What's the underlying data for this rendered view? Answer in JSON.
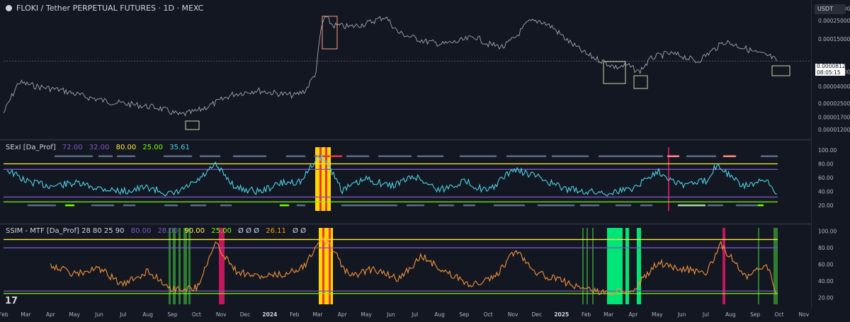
{
  "header": {
    "symbol_title": "FLOKI / Tether PERPETUAL FUTURES · 1D · MEXC",
    "currency_button": "USDT",
    "last_price": "0.00008129",
    "countdown": "08:05:15"
  },
  "indicator1": {
    "name": "SExI [Da_Prof]",
    "values": [
      {
        "text": "72.00",
        "color": "#7e57c2"
      },
      {
        "text": "32.00",
        "color": "#7e57c2"
      },
      {
        "text": "80.00",
        "color": "#ffeb3b"
      },
      {
        "text": "25.00",
        "color": "#76ff03"
      },
      {
        "text": "35.61",
        "color": "#4dd0e1"
      }
    ]
  },
  "indicator2": {
    "name": "SSIM - MTF [Da_Prof] 28 80 25 90",
    "values": [
      {
        "text": "80.00",
        "color": "#7e57c2"
      },
      {
        "text": "28.00",
        "color": "#7e57c2"
      },
      {
        "text": "90.00",
        "color": "#ffeb3b"
      },
      {
        "text": "25.00",
        "color": "#76ff03"
      },
      {
        "text": "Ø Ø Ø",
        "color": "#b2b5be"
      },
      {
        "text": "26.11",
        "color": "#ff9800"
      },
      {
        "text": "Ø Ø",
        "color": "#b2b5be"
      }
    ]
  },
  "colors": {
    "background": "#131722",
    "price_line": "#b2b5be",
    "sexi_line": "#4dd0e1",
    "ssim_line": "#f0913a",
    "upper_band": "#ffeb3b",
    "mid_band": "#7e57c2",
    "lower_band": "#76ff03",
    "dot_row": "#5d6b87",
    "highlight_yellow": "#ffd600",
    "highlight_green": "#00e676",
    "highlight_magenta": "#c2185b",
    "box_color": "#c4d9a8",
    "box_color_top": "#ff9e80"
  },
  "chart_data": [
    {
      "type": "line",
      "name": "FLOKI/USDT price (log scale)",
      "scale": "log",
      "x": [
        "2023-02-01",
        "2023-02-20",
        "2023-03-15",
        "2023-04-15",
        "2023-05-15",
        "2023-06-15",
        "2023-07-15",
        "2023-08-15",
        "2023-09-10",
        "2023-10-01",
        "2023-10-20",
        "2023-11-15",
        "2023-12-15",
        "2024-01-10",
        "2024-02-01",
        "2024-02-15",
        "2024-02-28",
        "2024-03-05",
        "2024-03-10",
        "2024-03-20",
        "2024-04-10",
        "2024-05-01",
        "2024-05-25",
        "2024-06-10",
        "2024-06-25",
        "2024-07-15",
        "2024-08-05",
        "2024-08-25",
        "2024-09-15",
        "2024-10-01",
        "2024-10-20",
        "2024-11-05",
        "2024-11-20",
        "2024-12-05",
        "2024-12-20",
        "2025-01-10",
        "2025-02-01",
        "2025-02-20",
        "2025-03-10",
        "2025-03-25",
        "2025-04-08",
        "2025-04-25",
        "2025-05-15",
        "2025-06-01",
        "2025-06-20",
        "2025-07-10",
        "2025-07-25",
        "2025-08-15",
        "2025-09-05",
        "2025-09-20",
        "2025-09-28"
      ],
      "y": [
        1.9e-05,
        4.5e-05,
        4e-05,
        3.6e-05,
        3e-05,
        2.6e-05,
        2.4e-05,
        2.2e-05,
        1.8e-05,
        2e-05,
        2.4e-05,
        3.2e-05,
        3.6e-05,
        3.3e-05,
        3.1e-05,
        3.6e-05,
        6e-05,
        0.00019,
        0.00028,
        0.00022,
        0.00021,
        0.00023,
        0.00028,
        0.00018,
        0.00016,
        0.00014,
        0.00013,
        0.00014,
        0.00016,
        0.00013,
        0.00012,
        0.00016,
        0.00024,
        0.00025,
        0.00021,
        0.00014,
        9.8e-05,
        8.2e-05,
        6.8e-05,
        7.2e-05,
        6e-05,
        9e-05,
        0.0001,
        9.4e-05,
        8e-05,
        0.00011,
        0.00014,
        0.00012,
        0.0001,
        9.2e-05,
        8.1e-05
      ],
      "yticks": [
        "0.00035000",
        "0.00025000",
        "0.00015000",
        "0.00008129",
        "0.00006000",
        "0.00004000",
        "0.00002500",
        "0.00001700",
        "0.00001200"
      ],
      "xticks": [
        "Feb",
        "Mar",
        "Apr",
        "May",
        "Jun",
        "Jul",
        "Aug",
        "Sep",
        "Oct",
        "Nov",
        "Dec",
        "2024",
        "Feb",
        "Mar",
        "Apr",
        "May",
        "Jun",
        "Jul",
        "Aug",
        "Sep",
        "Oct",
        "Nov",
        "Dec",
        "2025",
        "Feb",
        "Mar",
        "Apr",
        "May",
        "Jun",
        "Jul",
        "Aug",
        "Sep",
        "Oct",
        "Nov"
      ]
    },
    {
      "type": "line",
      "name": "SExI",
      "ylim": [
        12,
        104
      ],
      "yticks": [
        100,
        80,
        60,
        40,
        20
      ],
      "levels": [
        80,
        72,
        32,
        25
      ],
      "x": [
        "2023-02-05",
        "2023-03-01",
        "2023-04-01",
        "2023-05-01",
        "2023-06-01",
        "2023-07-01",
        "2023-08-01",
        "2023-09-01",
        "2023-10-01",
        "2023-10-25",
        "2023-11-20",
        "2023-12-20",
        "2024-01-15",
        "2024-02-10",
        "2024-03-01",
        "2024-03-10",
        "2024-04-01",
        "2024-05-01",
        "2024-06-01",
        "2024-07-01",
        "2024-08-01",
        "2024-09-01",
        "2024-10-01",
        "2024-11-01",
        "2024-12-01",
        "2025-01-01",
        "2025-02-01",
        "2025-03-01",
        "2025-04-01",
        "2025-05-01",
        "2025-06-01",
        "2025-07-01",
        "2025-07-15",
        "2025-08-15",
        "2025-09-15",
        "2025-09-28"
      ],
      "y": [
        72,
        55,
        48,
        52,
        45,
        40,
        46,
        35,
        54,
        78,
        45,
        40,
        52,
        55,
        90,
        88,
        42,
        58,
        48,
        62,
        42,
        55,
        40,
        72,
        62,
        45,
        40,
        38,
        45,
        70,
        50,
        55,
        80,
        48,
        55,
        36
      ]
    },
    {
      "type": "line",
      "name": "SSIM - MTF",
      "ylim": [
        12,
        104
      ],
      "yticks": [
        100,
        80,
        60,
        40,
        20
      ],
      "levels": [
        90,
        80,
        28,
        25
      ],
      "x": [
        "2023-04-01",
        "2023-05-01",
        "2023-06-01",
        "2023-07-01",
        "2023-08-01",
        "2023-09-01",
        "2023-10-01",
        "2023-10-25",
        "2023-11-20",
        "2023-12-20",
        "2024-01-20",
        "2024-02-15",
        "2024-03-05",
        "2024-03-15",
        "2024-04-10",
        "2024-05-10",
        "2024-06-10",
        "2024-07-10",
        "2024-08-10",
        "2024-09-10",
        "2024-10-10",
        "2024-11-05",
        "2024-12-01",
        "2025-01-01",
        "2025-02-01",
        "2025-03-01",
        "2025-04-01",
        "2025-05-01",
        "2025-06-01",
        "2025-07-01",
        "2025-07-20",
        "2025-08-20",
        "2025-09-15",
        "2025-09-28"
      ],
      "y": [
        60,
        48,
        55,
        35,
        52,
        30,
        32,
        85,
        52,
        45,
        48,
        60,
        92,
        85,
        45,
        55,
        42,
        70,
        50,
        35,
        45,
        78,
        50,
        40,
        30,
        25,
        30,
        62,
        55,
        50,
        84,
        45,
        60,
        26
      ]
    }
  ]
}
